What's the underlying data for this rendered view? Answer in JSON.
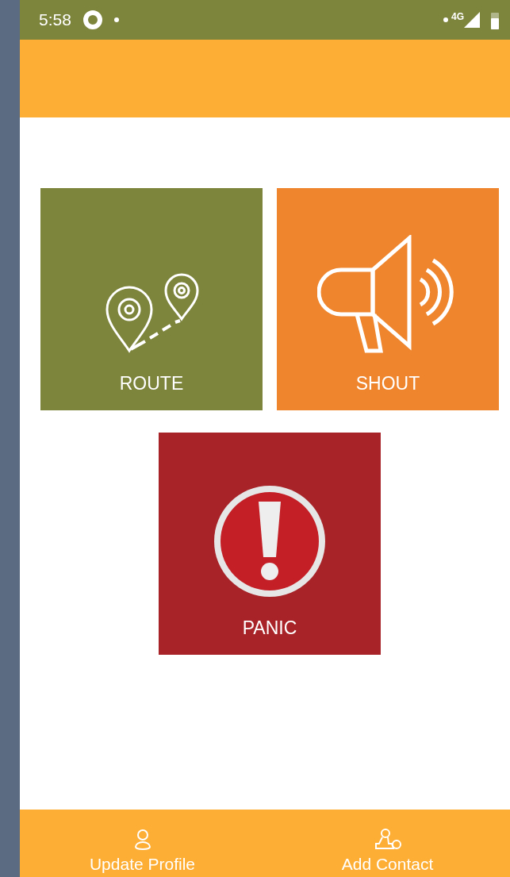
{
  "status_bar": {
    "time": "5:58",
    "network": "4G"
  },
  "tiles": [
    {
      "kind": "route",
      "label": "ROUTE",
      "color": "#7d843c"
    },
    {
      "kind": "shout",
      "label": "SHOUT",
      "color": "#ef862e"
    },
    {
      "kind": "panic",
      "label": "PANIC",
      "color": "#a72328"
    }
  ],
  "bottom_nav": [
    {
      "kind": "profile",
      "label": "Update Profile"
    },
    {
      "kind": "contact",
      "label": "Add Contact"
    }
  ]
}
